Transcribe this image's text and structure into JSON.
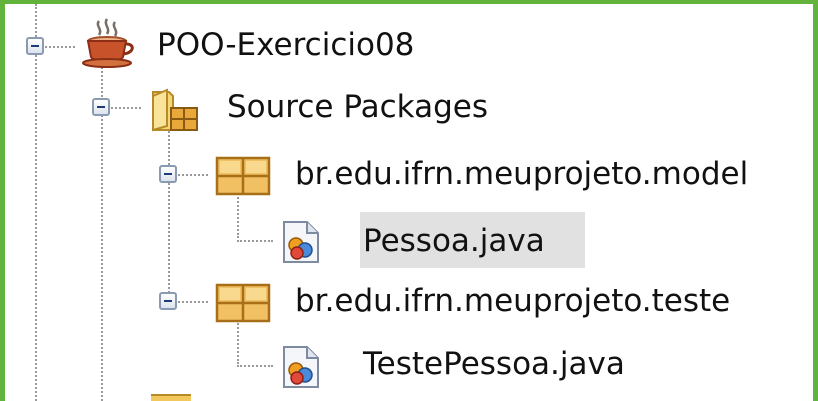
{
  "tree": {
    "project": {
      "label": "POO-Exercicio08",
      "icon": "java-cup-icon",
      "expanded": true
    },
    "source_packages": {
      "label": "Source Packages",
      "icon": "source-packages-folder-icon",
      "expanded": true
    },
    "packages": [
      {
        "label": "br.edu.ifrn.meuprojeto.model",
        "icon": "package-icon",
        "expanded": true,
        "files": [
          {
            "label": "Pessoa.java",
            "icon": "java-file-icon",
            "selected": true
          }
        ]
      },
      {
        "label": "br.edu.ifrn.meuprojeto.teste",
        "icon": "package-icon",
        "expanded": true,
        "files": [
          {
            "label": "TestePessoa.java",
            "icon": "java-file-icon",
            "selected": false
          }
        ]
      }
    ]
  },
  "colors": {
    "frame_border": "#62b33b",
    "selection": "#e1e1e1",
    "guide_lines": "#9a9a9a",
    "package_icon": "#e8b04a",
    "folder_icon": "#f2c75c"
  }
}
